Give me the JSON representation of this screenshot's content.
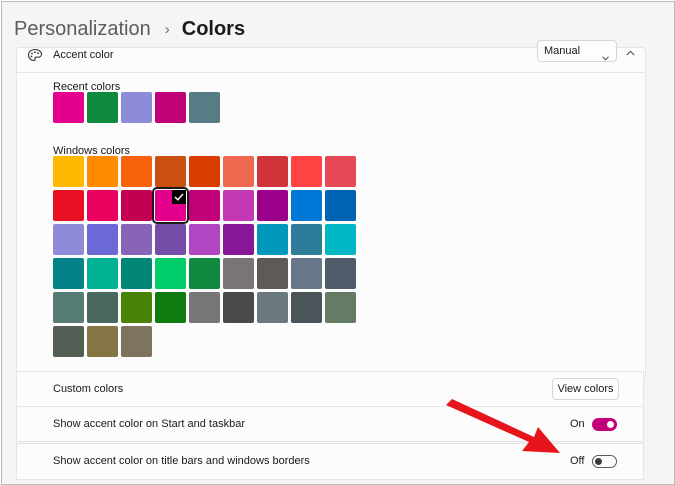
{
  "breadcrumb": {
    "parent": "Personalization",
    "separator": "›",
    "current": "Colors"
  },
  "accent": {
    "label": "Accent color",
    "mode_value": "Manual",
    "icon": "palette-icon"
  },
  "recent": {
    "label": "Recent colors",
    "colors": [
      "#e3008c",
      "#0f893e",
      "#8e8cd8",
      "#bf0077",
      "#567c86"
    ]
  },
  "windows": {
    "label": "Windows colors",
    "selected": 12,
    "colors": [
      "#ffb900",
      "#ff8c00",
      "#f7630c",
      "#ca5010",
      "#da3b01",
      "#ef6950",
      "#d13438",
      "#ff4343",
      "#e74856",
      "#e81123",
      "#ea005e",
      "#c30052",
      "#e3008c",
      "#bf0077",
      "#c239b3",
      "#9a0089",
      "#0078d7",
      "#0063b1",
      "#8e8cd8",
      "#6b69d6",
      "#8764b8",
      "#744da9",
      "#b146c2",
      "#881798",
      "#0099bc",
      "#2d7d9a",
      "#00b7c3",
      "#038387",
      "#00b294",
      "#018574",
      "#00cc6a",
      "#10893e",
      "#7a7574",
      "#5d5a58",
      "#68768a",
      "#515c6b",
      "#567c73",
      "#486860",
      "#498205",
      "#107c10",
      "#767676",
      "#4c4a48",
      "#69797e",
      "#4a5459",
      "#647c64",
      "#525e54",
      "#847545",
      "#7e735f"
    ]
  },
  "custom": {
    "label": "Custom colors",
    "button": "View colors"
  },
  "start_taskbar": {
    "label": "Show accent color on Start and taskbar",
    "state": "On"
  },
  "title_bars": {
    "label": "Show accent color on title bars and windows borders",
    "state": "Off"
  },
  "colors": {
    "accent": "#c2007a",
    "annotation_arrow": "#e8141c"
  }
}
